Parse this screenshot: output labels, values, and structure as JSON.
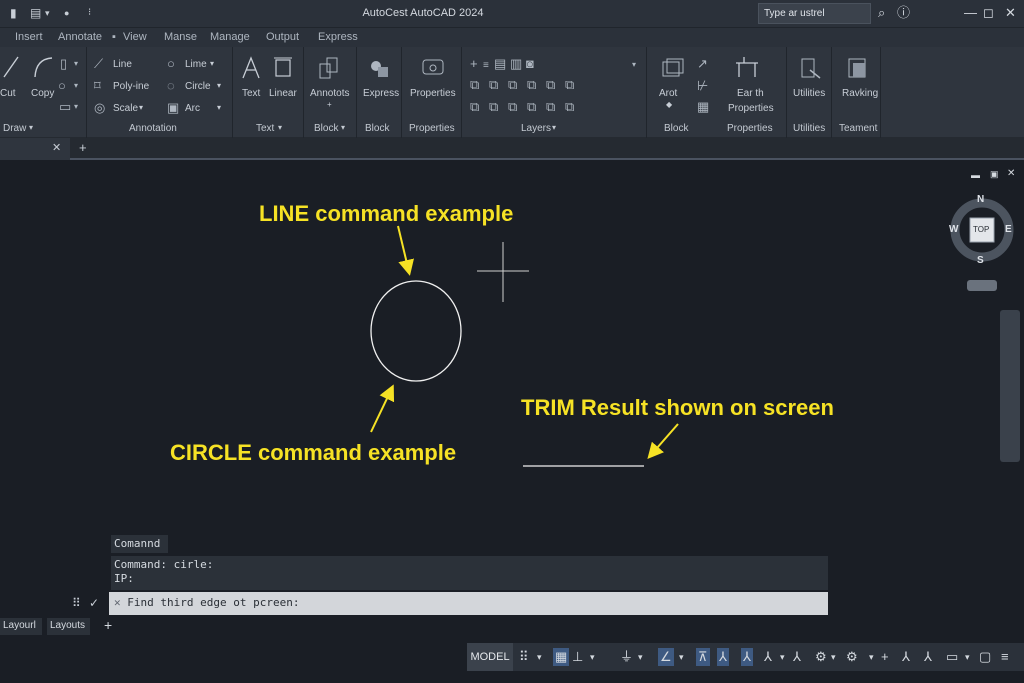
{
  "window": {
    "title": "AutoCest AutoCAD 2024",
    "search_placeholder": "Type ar ustrel"
  },
  "tabs": [
    "Insert",
    "Annotate",
    "View",
    "Manse",
    "Manage",
    "Output",
    "Express"
  ],
  "ribbon": {
    "draw": {
      "cut": "Cut",
      "copy": "Copy",
      "line": "Line",
      "polyline": "Poly-ine",
      "scale": "Scale",
      "lime": "Lime",
      "circle": "Circle",
      "arc": "Arc",
      "panel": "Draw",
      "annotation_panel": "Annotation"
    },
    "text": {
      "text": "Text",
      "linear": "Linear",
      "panel": "Text"
    },
    "block1": {
      "label": "Annotots",
      "panel": "Block"
    },
    "block2": {
      "label": "Express",
      "panel": "Block"
    },
    "properties1": {
      "label": "Properties",
      "panel": "Properties"
    },
    "layers": {
      "panel": "Layers"
    },
    "block3": {
      "label": "Arot",
      "panel": "Block"
    },
    "properties2": {
      "label1": "Ear th",
      "label2": "Properties",
      "panel": "Properties"
    },
    "utilities": {
      "label": "Utilities",
      "panel": "Utilities"
    },
    "teament": {
      "label": "Ravking",
      "panel": "Teament"
    }
  },
  "viewcube": {
    "n": "N",
    "s": "S",
    "e": "E",
    "w": "W",
    "face": "TOP"
  },
  "annotations": {
    "line_cmd": "LINE command example",
    "circle_cmd": "CIRCLE command example",
    "trim_result": "TRIM Result shown on screen"
  },
  "command": {
    "title": "Comannd",
    "history": [
      "Command: cirle:",
      "IP:"
    ],
    "input": "Find third edge ot pcreen:"
  },
  "layouts": [
    "Layourl",
    "Layouts"
  ],
  "status": {
    "model": "MODEL"
  },
  "colors": {
    "accent_yellow": "#f6e225",
    "canvas": "#1a1e25",
    "ribbon": "#2f353e"
  }
}
